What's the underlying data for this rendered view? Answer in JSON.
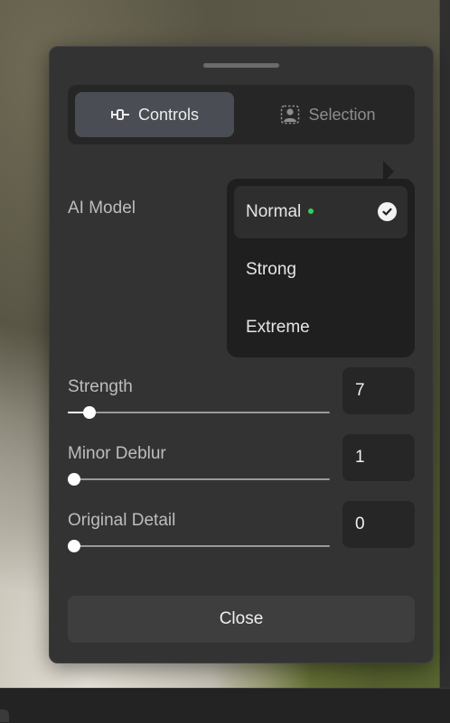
{
  "tabs": [
    {
      "label": "Controls",
      "icon": "slider-toggle-icon",
      "active": true
    },
    {
      "label": "Selection",
      "icon": "person-select-icon",
      "active": false
    }
  ],
  "ai_model": {
    "label": "AI Model",
    "options": [
      {
        "label": "Normal",
        "selected": true,
        "indicator_color": "#2fd158"
      },
      {
        "label": "Strong",
        "selected": false
      },
      {
        "label": "Extreme",
        "selected": false
      }
    ]
  },
  "sliders": [
    {
      "label": "Strength",
      "value": "7",
      "fraction": 0.06
    },
    {
      "label": "Minor Deblur",
      "value": "1",
      "fraction": 0.0
    },
    {
      "label": "Original Detail",
      "value": "0",
      "fraction": 0.0
    }
  ],
  "close_label": "Close",
  "colors": {
    "panel_bg": "#333334",
    "accent_active_tab": "#4a4d53",
    "status_dot": "#2fd158"
  }
}
